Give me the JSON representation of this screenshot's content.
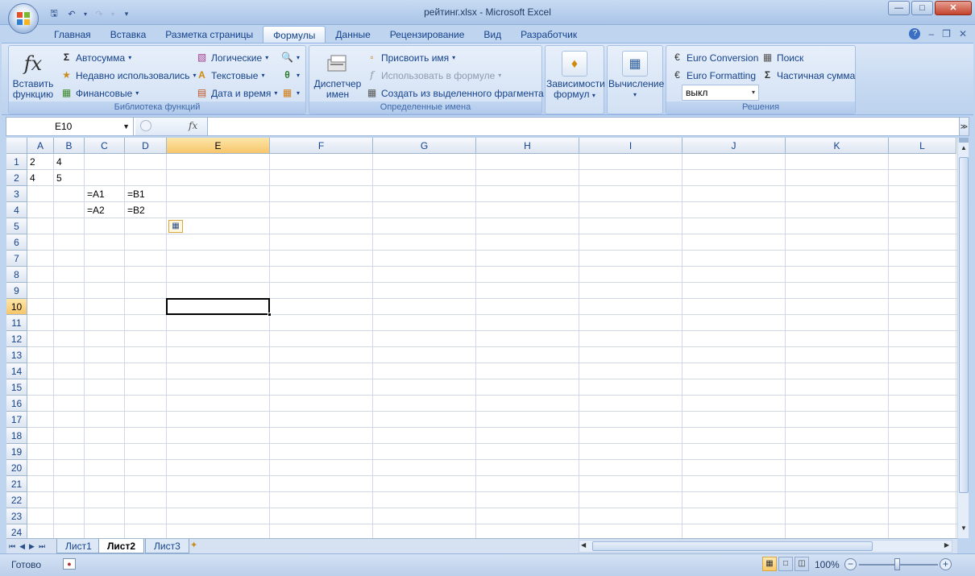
{
  "window": {
    "title": "рейтинг.xlsx - Microsoft Excel"
  },
  "tabs": [
    "Главная",
    "Вставка",
    "Разметка страницы",
    "Формулы",
    "Данные",
    "Рецензирование",
    "Вид",
    "Разработчик"
  ],
  "active_tab": "Формулы",
  "ribbon": {
    "insert_fn": {
      "line1": "Вставить",
      "line2": "функцию"
    },
    "autosum": "Автосумма",
    "recent": "Недавно использовались",
    "financial": "Финансовые",
    "logical": "Логические",
    "text_fn": "Текстовые",
    "datetime": "Дата и время",
    "lib_label": "Библиотека функций",
    "name_mgr": {
      "line1": "Диспетчер",
      "line2": "имен"
    },
    "assign_name": "Присвоить имя",
    "use_in_formula": "Использовать в формуле",
    "create_from_sel": "Создать из выделенного фрагмента",
    "names_label": "Определенные имена",
    "dependencies": {
      "line1": "Зависимости",
      "line2": "формул"
    },
    "calculation": "Вычисление",
    "euro_conversion": "Euro Conversion",
    "euro_formatting": "Euro Formatting",
    "search": "Поиск",
    "partial_sum": "Частичная сумма",
    "off_value": "выкл",
    "solutions_label": "Решения"
  },
  "formula_bar": {
    "name_box": "E10",
    "fx": "fx",
    "formula": ""
  },
  "columns": [
    "A",
    "B",
    "C",
    "D",
    "E",
    "F",
    "G",
    "H",
    "I",
    "J",
    "K",
    "L"
  ],
  "rows": [
    "1",
    "2",
    "3",
    "4",
    "5",
    "6",
    "7",
    "8",
    "9",
    "10",
    "11",
    "12",
    "13",
    "14",
    "15",
    "16",
    "17",
    "18",
    "19",
    "20",
    "21",
    "22",
    "23",
    "24"
  ],
  "cells": {
    "A1": "2",
    "B1": "4",
    "A2": "4",
    "B2": "5",
    "C3": "=A1",
    "D3": "=B1",
    "C4": "=A2",
    "D4": "=B2"
  },
  "selected_cell": "E10",
  "sheets": [
    "Лист1",
    "Лист2",
    "Лист3"
  ],
  "active_sheet": "Лист2",
  "status": {
    "ready": "Готово",
    "zoom": "100%"
  }
}
